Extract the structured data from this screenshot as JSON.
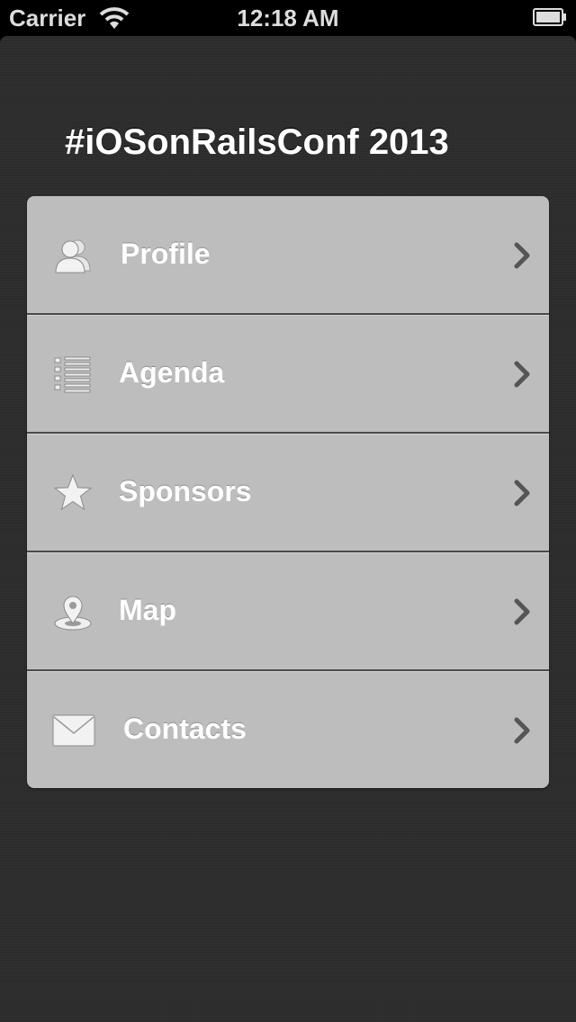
{
  "status_bar": {
    "carrier": "Carrier",
    "time": "12:18 AM"
  },
  "app": {
    "title": "#iOSonRailsConf 2013"
  },
  "menu": {
    "items": [
      {
        "label": "Profile",
        "icon": "profile-icon"
      },
      {
        "label": "Agenda",
        "icon": "list-icon"
      },
      {
        "label": "Sponsors",
        "icon": "star-icon"
      },
      {
        "label": "Map",
        "icon": "map-pin-icon"
      },
      {
        "label": "Contacts",
        "icon": "envelope-icon"
      }
    ]
  },
  "colors": {
    "background": "#2d2d2d",
    "menu_item": "#bdbdbd",
    "separator": "#4a4a4a",
    "text": "#ffffff",
    "chevron": "#555555"
  }
}
